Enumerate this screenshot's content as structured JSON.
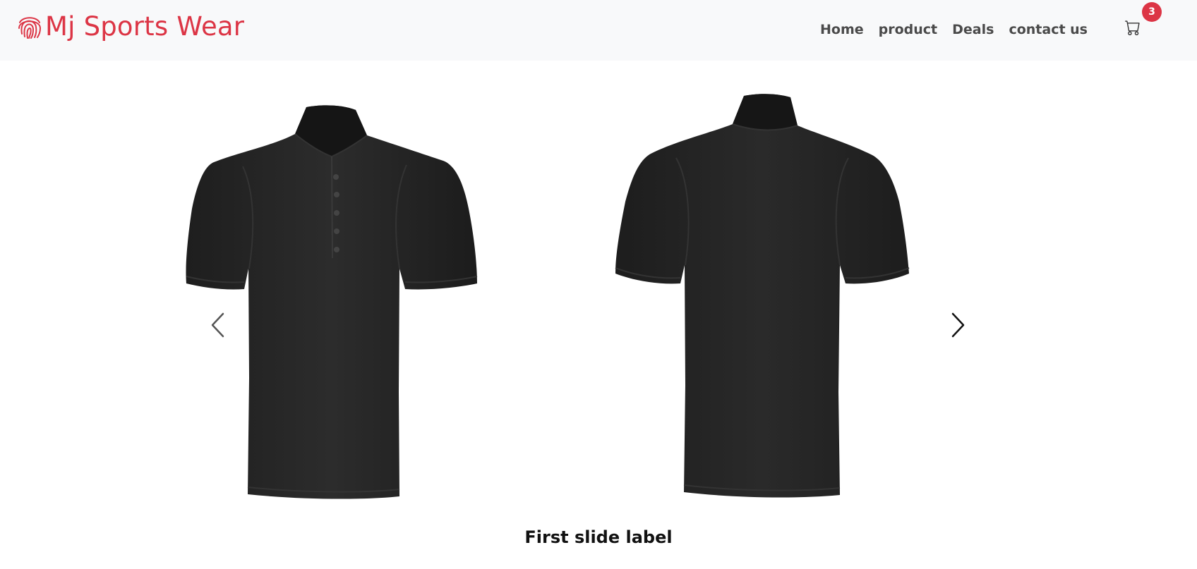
{
  "brand": {
    "name": "Mj Sports Wear",
    "icon": "fingerprint-icon",
    "color": "#dc3545"
  },
  "nav": {
    "items": [
      {
        "label": "Home"
      },
      {
        "label": "product"
      },
      {
        "label": "Deals"
      },
      {
        "label": "contact us"
      }
    ]
  },
  "cart": {
    "icon": "cart-icon",
    "count": "3",
    "badge_color": "#dc3545"
  },
  "carousel": {
    "slides": [
      {
        "caption": "First slide label",
        "images": [
          "polo-shirt-front",
          "polo-shirt-back"
        ]
      }
    ],
    "active_index": 0,
    "prev_icon": "chevron-left-icon",
    "next_icon": "chevron-right-icon"
  }
}
